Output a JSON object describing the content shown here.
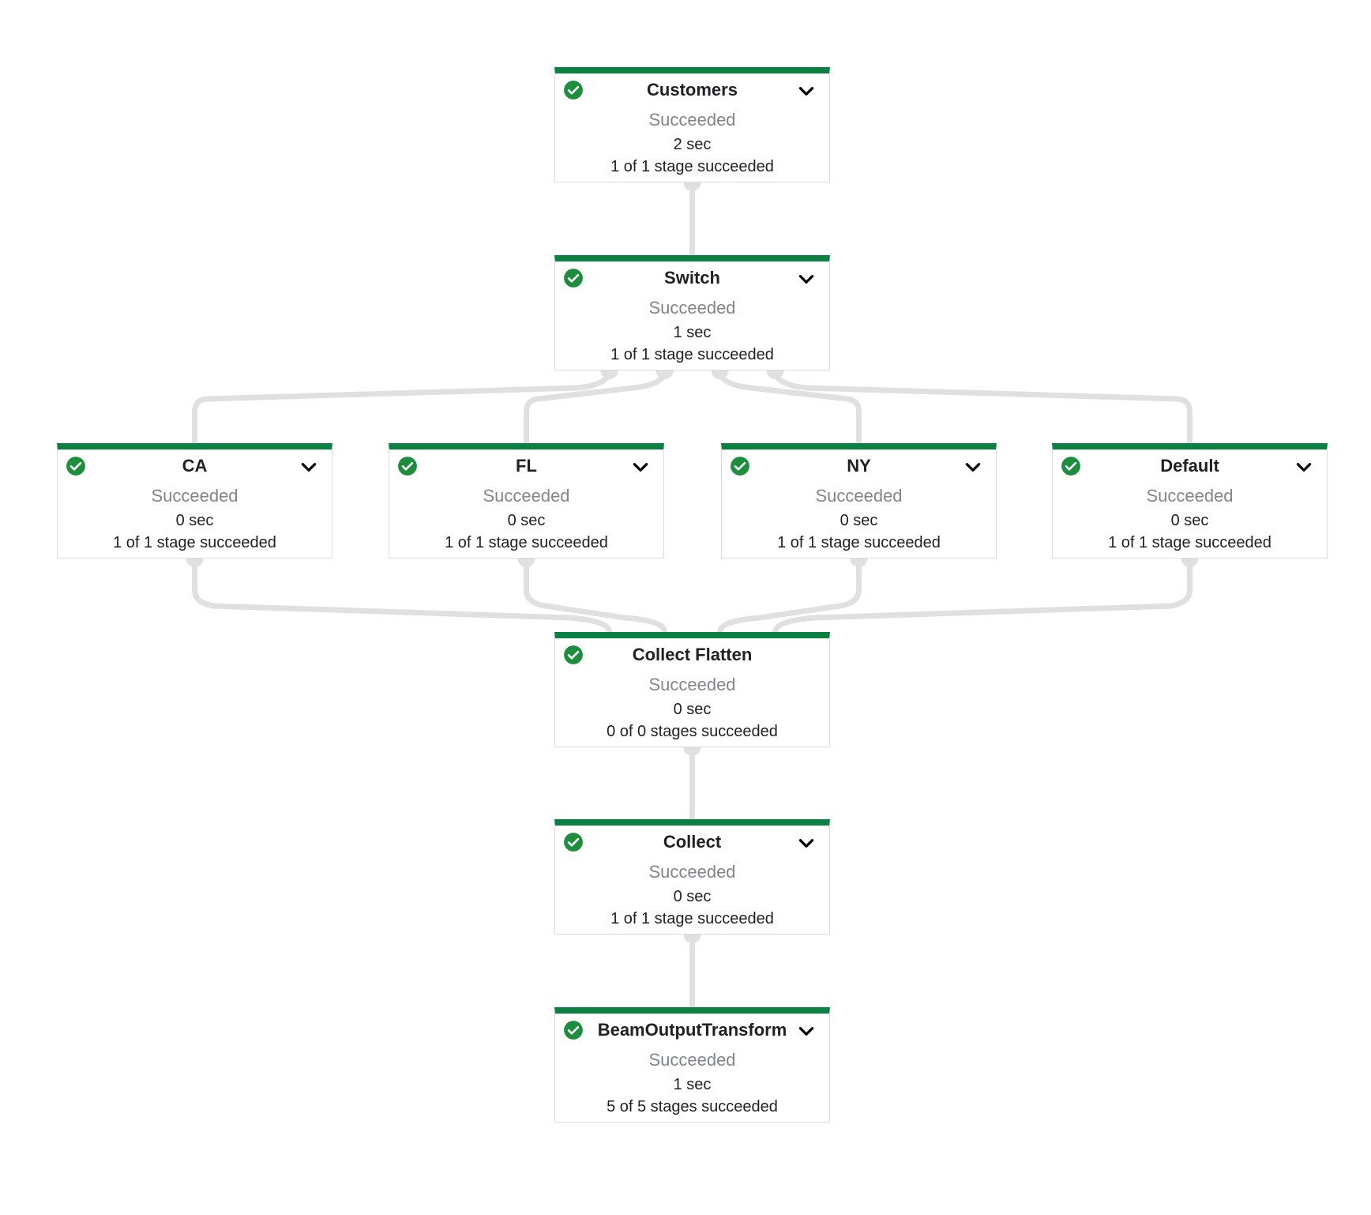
{
  "colors": {
    "success": "#0b8043",
    "check": "#1e8e3e",
    "edge": "#e0e0e0",
    "muted_text": "#80868b",
    "text": "#202124"
  },
  "nodes": [
    {
      "id": "customers",
      "title": "Customers",
      "state": "Succeeded",
      "duration": "2 sec",
      "stages": "1 of 1 stage succeeded",
      "status_icon": "check-circle-icon",
      "expandable": true
    },
    {
      "id": "switch",
      "title": "Switch",
      "state": "Succeeded",
      "duration": "1 sec",
      "stages": "1 of 1 stage succeeded",
      "status_icon": "check-circle-icon",
      "expandable": true
    },
    {
      "id": "ca",
      "title": "CA",
      "state": "Succeeded",
      "duration": "0 sec",
      "stages": "1 of 1 stage succeeded",
      "status_icon": "check-circle-icon",
      "expandable": true
    },
    {
      "id": "fl",
      "title": "FL",
      "state": "Succeeded",
      "duration": "0 sec",
      "stages": "1 of 1 stage succeeded",
      "status_icon": "check-circle-icon",
      "expandable": true
    },
    {
      "id": "ny",
      "title": "NY",
      "state": "Succeeded",
      "duration": "0 sec",
      "stages": "1 of 1 stage succeeded",
      "status_icon": "check-circle-icon",
      "expandable": true
    },
    {
      "id": "default",
      "title": "Default",
      "state": "Succeeded",
      "duration": "0 sec",
      "stages": "1 of 1 stage succeeded",
      "status_icon": "check-circle-icon",
      "expandable": true
    },
    {
      "id": "collect-flatten",
      "title": "Collect Flatten",
      "state": "Succeeded",
      "duration": "0 sec",
      "stages": "0 of 0 stages succeeded",
      "status_icon": "check-circle-icon",
      "expandable": false
    },
    {
      "id": "collect",
      "title": "Collect",
      "state": "Succeeded",
      "duration": "0 sec",
      "stages": "1 of 1 stage succeeded",
      "status_icon": "check-circle-icon",
      "expandable": true
    },
    {
      "id": "beam-output-transform",
      "title": "BeamOutputTransform",
      "state": "Succeeded",
      "duration": "1 sec",
      "stages": "5 of 5 stages succeeded",
      "status_icon": "check-circle-icon",
      "expandable": true
    }
  ],
  "edges": [
    {
      "from": "customers",
      "to": "switch"
    },
    {
      "from": "switch",
      "to": "ca"
    },
    {
      "from": "switch",
      "to": "fl"
    },
    {
      "from": "switch",
      "to": "ny"
    },
    {
      "from": "switch",
      "to": "default"
    },
    {
      "from": "ca",
      "to": "collect-flatten"
    },
    {
      "from": "fl",
      "to": "collect-flatten"
    },
    {
      "from": "ny",
      "to": "collect-flatten"
    },
    {
      "from": "default",
      "to": "collect-flatten"
    },
    {
      "from": "collect-flatten",
      "to": "collect"
    },
    {
      "from": "collect",
      "to": "beam-output-transform"
    }
  ]
}
